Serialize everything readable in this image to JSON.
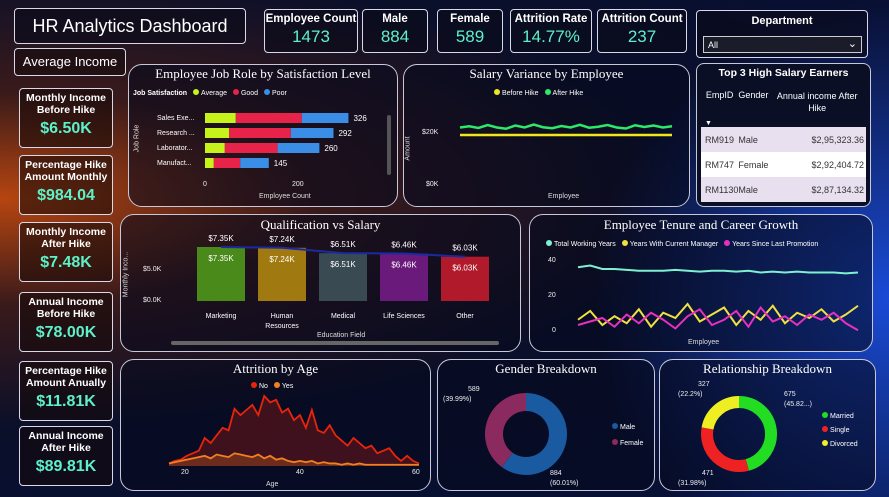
{
  "title": "HR Analytics Dashboard",
  "kpis": {
    "employee_count": {
      "label": "Employee Count",
      "value": "1473"
    },
    "male": {
      "label": "Male",
      "value": "884"
    },
    "female": {
      "label": "Female",
      "value": "589"
    },
    "attrition_rate": {
      "label": "Attrition Rate",
      "value": "14.77%"
    },
    "attrition_count": {
      "label": "Attrition Count",
      "value": "237"
    }
  },
  "department": {
    "label": "Department",
    "selected": "All"
  },
  "average_income": {
    "title": "Average Income",
    "cards": [
      {
        "label": "Monthly Income Before Hike",
        "value": "$6.50K"
      },
      {
        "label": "Percentage Hike Amount Monthly",
        "value": "$984.04"
      },
      {
        "label": "Monthly Income After Hike",
        "value": "$7.48K"
      },
      {
        "label": "Annual Income Before Hike",
        "value": "$78.00K"
      },
      {
        "label": "Percentage Hike Amount Anually",
        "value": "$11.81K"
      },
      {
        "label": "Annual Income After Hike",
        "value": "$89.81K"
      }
    ]
  },
  "job_role": {
    "title": "Employee Job Role by Satisfaction Level",
    "legend_title": "Job Satisfaction",
    "legend": [
      {
        "name": "Average",
        "color": "#c6f31a"
      },
      {
        "name": "Good",
        "color": "#e8234a"
      },
      {
        "name": "Poor",
        "color": "#3a8ee6"
      }
    ],
    "ylabel": "Job Role",
    "xlabel": "Employee Count",
    "xticks": [
      "0",
      "200"
    ]
  },
  "salary_variance": {
    "title": "Salary Variance by Employee",
    "legend": [
      {
        "name": "Before Hike",
        "color": "#f0e61e"
      },
      {
        "name": "After Hike",
        "color": "#2ee86a"
      }
    ],
    "ylabel": "Amount",
    "xlabel": "Employee",
    "yticks": [
      "$20K",
      "$0K"
    ]
  },
  "top_earners": {
    "title": "Top 3 High Salary Earners",
    "columns": [
      "EmpID",
      "Gender",
      "Annual income After Hike"
    ],
    "rows": [
      [
        "RM919",
        "Male",
        "$2,95,323.36"
      ],
      [
        "RM747",
        "Female",
        "$2,92,404.72"
      ],
      [
        "RM1130",
        "Male",
        "$2,87,134.32"
      ]
    ]
  },
  "qualification": {
    "title": "Qualification vs Salary",
    "ylabel": "Monthly Inco...",
    "xlabel": "Education Field",
    "yticks": [
      "$5.0K",
      "$0.0K"
    ]
  },
  "tenure": {
    "title": "Employee Tenure and Career Growth",
    "legend": [
      {
        "name": "Total Working Years",
        "color": "#7ef0d0"
      },
      {
        "name": "Years With Current Manager",
        "color": "#f0e040"
      },
      {
        "name": "Years Since Last Promotion",
        "color": "#e830c0"
      }
    ],
    "xlabel": "Employee",
    "yticks": [
      "40",
      "20",
      "0"
    ]
  },
  "attrition_age": {
    "title": "Attrition by Age",
    "legend": [
      {
        "name": "No",
        "color": "#e8240a"
      },
      {
        "name": "Yes",
        "color": "#f08020"
      }
    ],
    "xlabel": "Age",
    "xticks": [
      "20",
      "40",
      "60"
    ]
  },
  "gender": {
    "title": "Gender Breakdown",
    "labels": {
      "female_value": "589",
      "female_pct": "(39.99%)",
      "male_value": "884",
      "male_pct": "(60.01%)"
    },
    "legend": [
      {
        "name": "Male",
        "color": "#1a5aa0"
      },
      {
        "name": "Female",
        "color": "#8a2a5e"
      }
    ]
  },
  "relationship": {
    "title": "Relationship Breakdown",
    "labels": {
      "divorced_value": "327",
      "divorced_pct": "(22.2%)",
      "married_value": "675",
      "married_pct": "(45.82...)",
      "single_value": "471",
      "single_pct": "(31.98%)"
    },
    "legend": [
      {
        "name": "Married",
        "color": "#22dd22"
      },
      {
        "name": "Single",
        "color": "#ee2222"
      },
      {
        "name": "Divorced",
        "color": "#eeee22"
      }
    ]
  },
  "chart_data": [
    {
      "type": "bar",
      "title": "Employee Job Role by Satisfaction Level",
      "categories": [
        "Sales Exe...",
        "Research ...",
        "Laborator...",
        "Manufact..."
      ],
      "series": [
        {
          "name": "Average",
          "values": [
            70,
            55,
            45,
            20
          ]
        },
        {
          "name": "Good",
          "values": [
            150,
            140,
            120,
            60
          ]
        },
        {
          "name": "Poor",
          "values": [
            106,
            97,
            95,
            65
          ]
        }
      ],
      "totals": [
        "326",
        "292",
        "260",
        "145"
      ],
      "xlim": [
        0,
        350
      ]
    },
    {
      "type": "line",
      "title": "Salary Variance by Employee",
      "series": [
        {
          "name": "Before Hike",
          "values": [
            20,
            20,
            20,
            20,
            20,
            20,
            20,
            20,
            20,
            20,
            20,
            20,
            20,
            20,
            20,
            20,
            20,
            20,
            20,
            20,
            20,
            20,
            20,
            20
          ]
        },
        {
          "name": "After Hike",
          "values": [
            23,
            23.5,
            22.8,
            24,
            23,
            22.5,
            23.8,
            23,
            24.2,
            23.1,
            22.7,
            23.6,
            23,
            24.1,
            22.9,
            23.3,
            24,
            23,
            22.6,
            23.9,
            23.2,
            23.8,
            23,
            23.5
          ]
        }
      ],
      "ylim": [
        0,
        30
      ]
    },
    {
      "type": "bar",
      "title": "Qualification vs Salary",
      "categories": [
        "Marketing",
        "Human Resources",
        "Medical",
        "Life Sciences",
        "Other"
      ],
      "values": [
        7.35,
        7.24,
        6.51,
        6.46,
        6.03
      ],
      "value_labels": [
        "$7.35K",
        "$7.24K",
        "$6.51K",
        "$6.46K",
        "$6.03K"
      ],
      "colors": [
        "#4a8a1a",
        "#a07a10",
        "#3a4a52",
        "#6a1a7a",
        "#b01a2a"
      ],
      "ylim": [
        0,
        8
      ]
    },
    {
      "type": "line",
      "title": "Employee Tenure and Career Growth",
      "series": [
        {
          "name": "Total Working Years",
          "values": [
            37,
            38,
            36,
            36,
            35.5,
            35,
            35,
            35,
            35.5,
            35,
            34.5,
            35,
            35,
            34.5,
            35,
            34,
            34.5,
            34,
            34.5,
            34,
            34,
            34,
            33.5,
            34
          ]
        },
        {
          "name": "Years With Current Manager",
          "values": [
            7,
            12,
            4,
            9,
            5,
            13,
            3,
            11,
            8,
            16,
            6,
            10,
            14,
            4,
            12,
            7,
            15,
            5,
            11,
            8,
            13,
            6,
            10,
            15
          ]
        },
        {
          "name": "Years Since Last Promotion",
          "values": [
            4,
            6,
            8,
            3,
            10,
            5,
            11,
            7,
            2,
            9,
            13,
            4,
            7,
            12,
            3,
            14,
            6,
            9,
            4,
            10,
            7,
            11,
            5,
            1
          ]
        }
      ],
      "ylim": [
        0,
        45
      ]
    },
    {
      "type": "area",
      "title": "Attrition by Age",
      "x": [
        18,
        19,
        20,
        21,
        22,
        23,
        24,
        25,
        26,
        27,
        28,
        29,
        30,
        31,
        32,
        33,
        34,
        35,
        36,
        37,
        38,
        39,
        40,
        41,
        42,
        43,
        44,
        45,
        46,
        47,
        48,
        49,
        50,
        51,
        52,
        53,
        54,
        55,
        56,
        57,
        58,
        59,
        60
      ],
      "series": [
        {
          "name": "No",
          "values": [
            2,
            4,
            5,
            8,
            10,
            12,
            22,
            18,
            24,
            30,
            28,
            45,
            40,
            44,
            48,
            40,
            55,
            50,
            52,
            42,
            45,
            36,
            40,
            30,
            44,
            28,
            26,
            32,
            24,
            20,
            16,
            22,
            18,
            14,
            16,
            10,
            12,
            14,
            8,
            4,
            8,
            4,
            2
          ]
        },
        {
          "name": "Yes",
          "values": [
            2,
            3,
            4,
            5,
            6,
            7,
            8,
            6,
            9,
            8,
            7,
            10,
            9,
            8,
            7,
            9,
            6,
            8,
            5,
            6,
            4,
            3,
            4,
            3,
            4,
            2,
            3,
            2,
            2,
            1,
            2,
            1,
            2,
            1,
            1,
            1,
            1,
            1,
            1,
            1,
            1,
            1,
            1
          ]
        }
      ],
      "xlim": [
        18,
        60
      ]
    },
    {
      "type": "pie",
      "title": "Gender Breakdown",
      "categories": [
        "Male",
        "Female"
      ],
      "values": [
        884,
        589
      ]
    },
    {
      "type": "pie",
      "title": "Relationship Breakdown",
      "categories": [
        "Married",
        "Single",
        "Divorced"
      ],
      "values": [
        675,
        471,
        327
      ]
    }
  ]
}
